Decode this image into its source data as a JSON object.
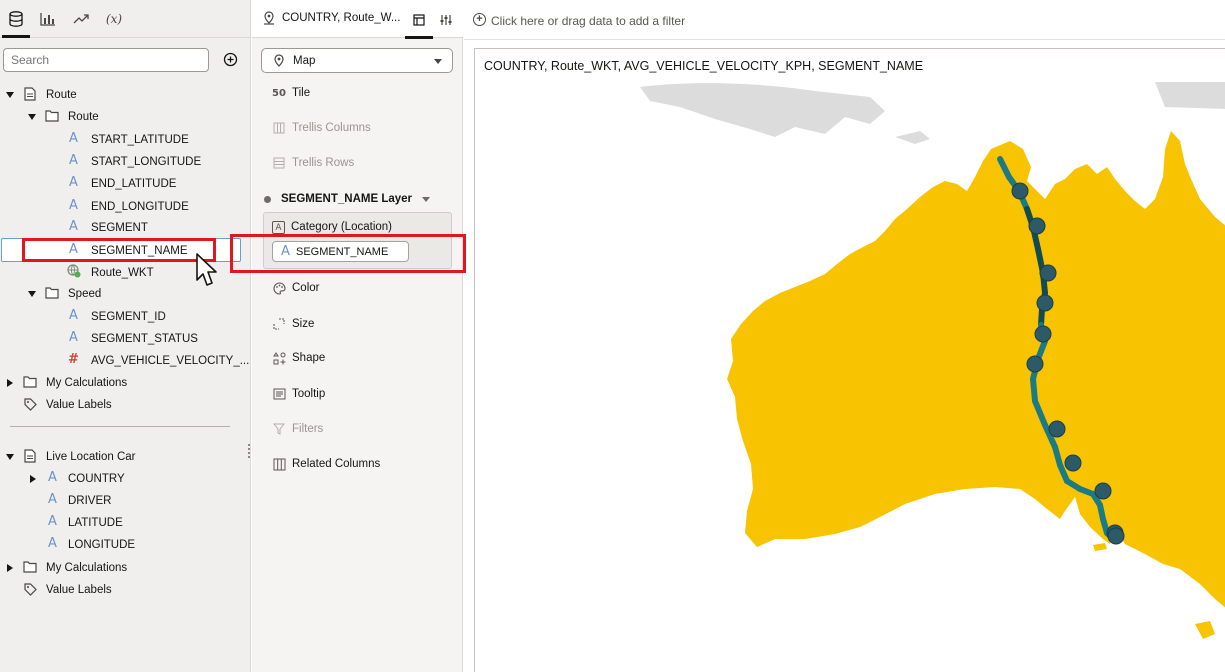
{
  "left_panel": {
    "tabs": [
      {
        "name": "data-tab-icon",
        "active": true
      },
      {
        "name": "visualizations-tab-icon",
        "active": false
      },
      {
        "name": "analytics-tab-icon",
        "active": false
      },
      {
        "name": "variables-tab-icon",
        "active": false,
        "text": "(x)"
      }
    ],
    "search_placeholder": "Search",
    "tree": {
      "route_dataset": "Route",
      "route_folder": "Route",
      "route_columns": [
        "START_LATITUDE",
        "START_LONGITUDE",
        "END_LATITUDE",
        "END_LONGITUDE",
        "SEGMENT",
        "SEGMENT_NAME",
        "Route_WKT"
      ],
      "speed_folder": "Speed",
      "speed_columns": [
        "SEGMENT_ID",
        "SEGMENT_STATUS",
        "AVG_VEHICLE_VELOCITY_..."
      ],
      "my_calculations_1": "My Calculations",
      "value_labels_1": "Value Labels",
      "live_dataset": "Live Location Car",
      "live_columns": [
        "COUNTRY",
        "DRIVER",
        "LATITUDE",
        "LONGITUDE"
      ],
      "my_calculations_2": "My Calculations",
      "value_labels_2": "Value Labels"
    }
  },
  "middle_panel": {
    "header_title": "COUNTRY, Route_W...",
    "viz_type": "Map",
    "grammar": {
      "tile": "Tile",
      "trellis_columns": "Trellis Columns",
      "trellis_rows": "Trellis Rows",
      "layer": "SEGMENT_NAME Layer",
      "category": "Category (Location)",
      "category_pill": "SEGMENT_NAME",
      "color": "Color",
      "size": "Size",
      "shape": "Shape",
      "tooltip": "Tooltip",
      "filters": "Filters",
      "related_columns": "Related Columns"
    }
  },
  "canvas": {
    "filter_text": "Click here or drag data to add a filter",
    "viz_title": "COUNTRY, Route_WKT, AVG_VEHICLE_VELOCITY_KPH, SEGMENT_NAME"
  },
  "colors": {
    "land": "#f8c300",
    "route_line": "#1b7b84",
    "route_line_dark": "#124c4e",
    "route_node": "#2c5a68",
    "highlight": "#e0171f",
    "neighbor_land": "#dcdcdc"
  }
}
